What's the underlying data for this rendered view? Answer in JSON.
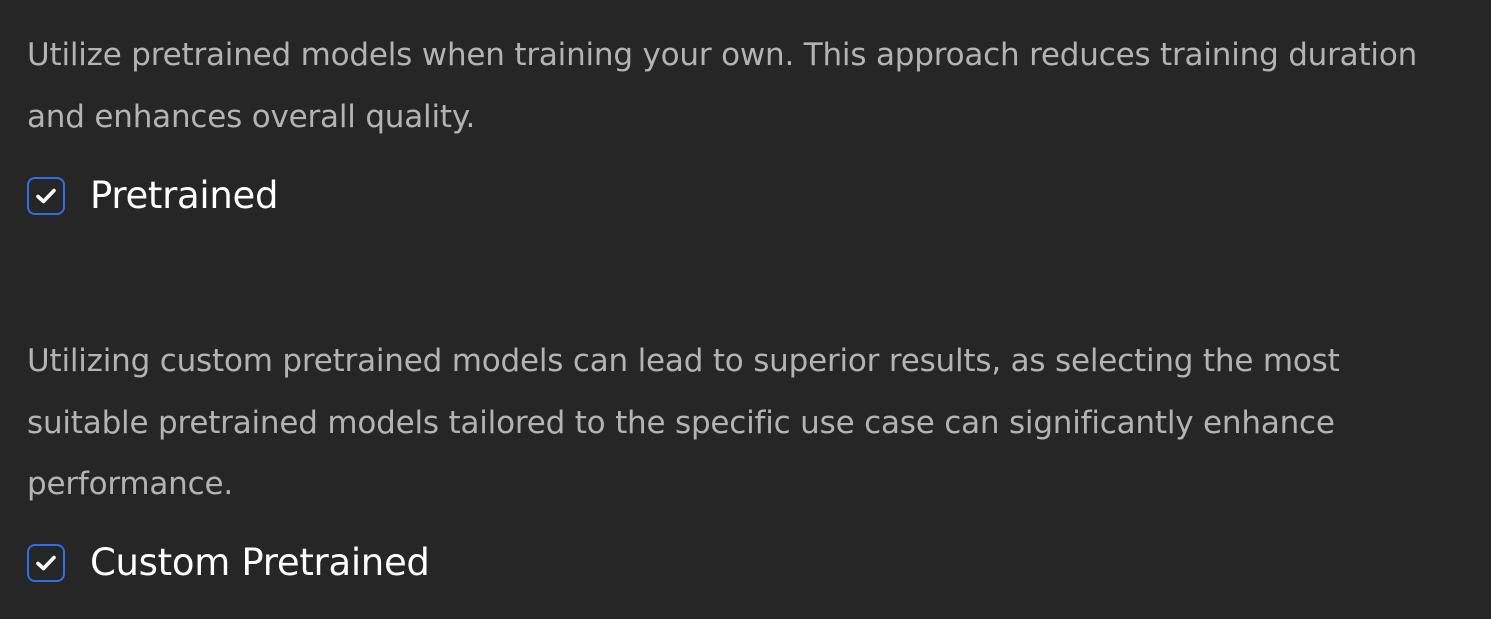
{
  "sections": [
    {
      "description": "Utilize pretrained models when training your own. This approach reduces training duration and enhances overall quality.",
      "checkbox": {
        "label": "Pretrained",
        "checked": true
      }
    },
    {
      "description": "Utilizing custom pretrained models can lead to superior results, as selecting the most suitable pretrained models tailored to the specific use case can significantly enhance performance.",
      "checkbox": {
        "label": "Custom Pretrained",
        "checked": true
      }
    }
  ],
  "colors": {
    "background": "#262626",
    "description_text": "#b3b3b3",
    "label_text": "#ffffff",
    "checkbox_border": "#2f6fe6",
    "checkmark": "#ffffff"
  },
  "icons": {
    "checkbox_checked": "check-icon"
  }
}
